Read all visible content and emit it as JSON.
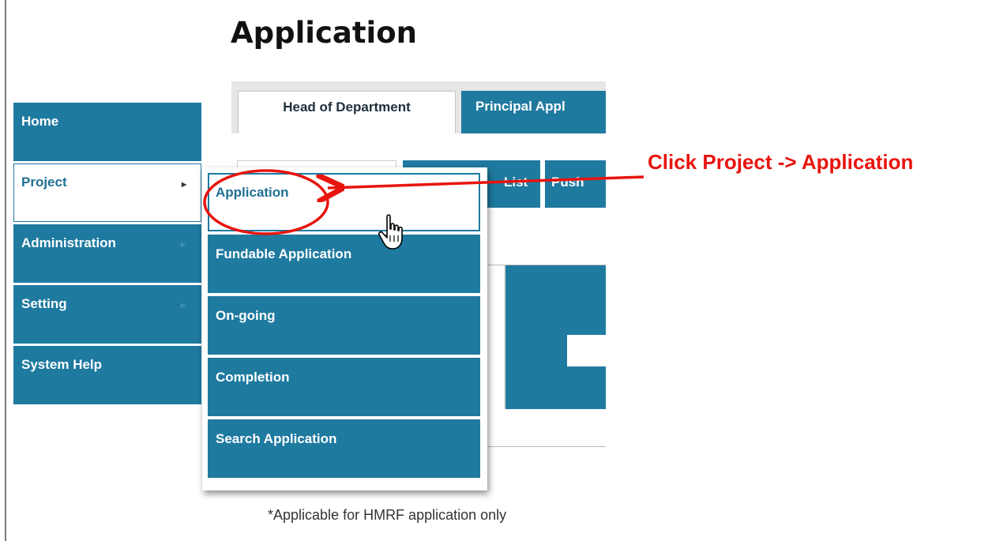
{
  "page": {
    "title": "Application"
  },
  "tabs": [
    {
      "label": "Head of Department"
    },
    {
      "label": "Principal Appl"
    }
  ],
  "sub_tabs": [
    {
      "label": "List"
    },
    {
      "label": "Push"
    }
  ],
  "nav": {
    "items": [
      {
        "label": "Home"
      },
      {
        "label": "Project"
      },
      {
        "label": "Administration"
      },
      {
        "label": "Setting"
      },
      {
        "label": "System Help"
      }
    ],
    "arrow_glyph": "▸"
  },
  "submenu": {
    "items": [
      {
        "label": "Application"
      },
      {
        "label": "Fundable Application"
      },
      {
        "label": "On-going"
      },
      {
        "label": "Completion"
      },
      {
        "label": "Search Application"
      }
    ]
  },
  "annotation": {
    "text": "Click Project -> Application",
    "color": "#e8140e"
  },
  "footnote": "*Applicable for HMRF application only",
  "colors": {
    "brand_blue": "#1f7aa0"
  },
  "icons": {
    "cursor": "hand-pointer-icon"
  }
}
